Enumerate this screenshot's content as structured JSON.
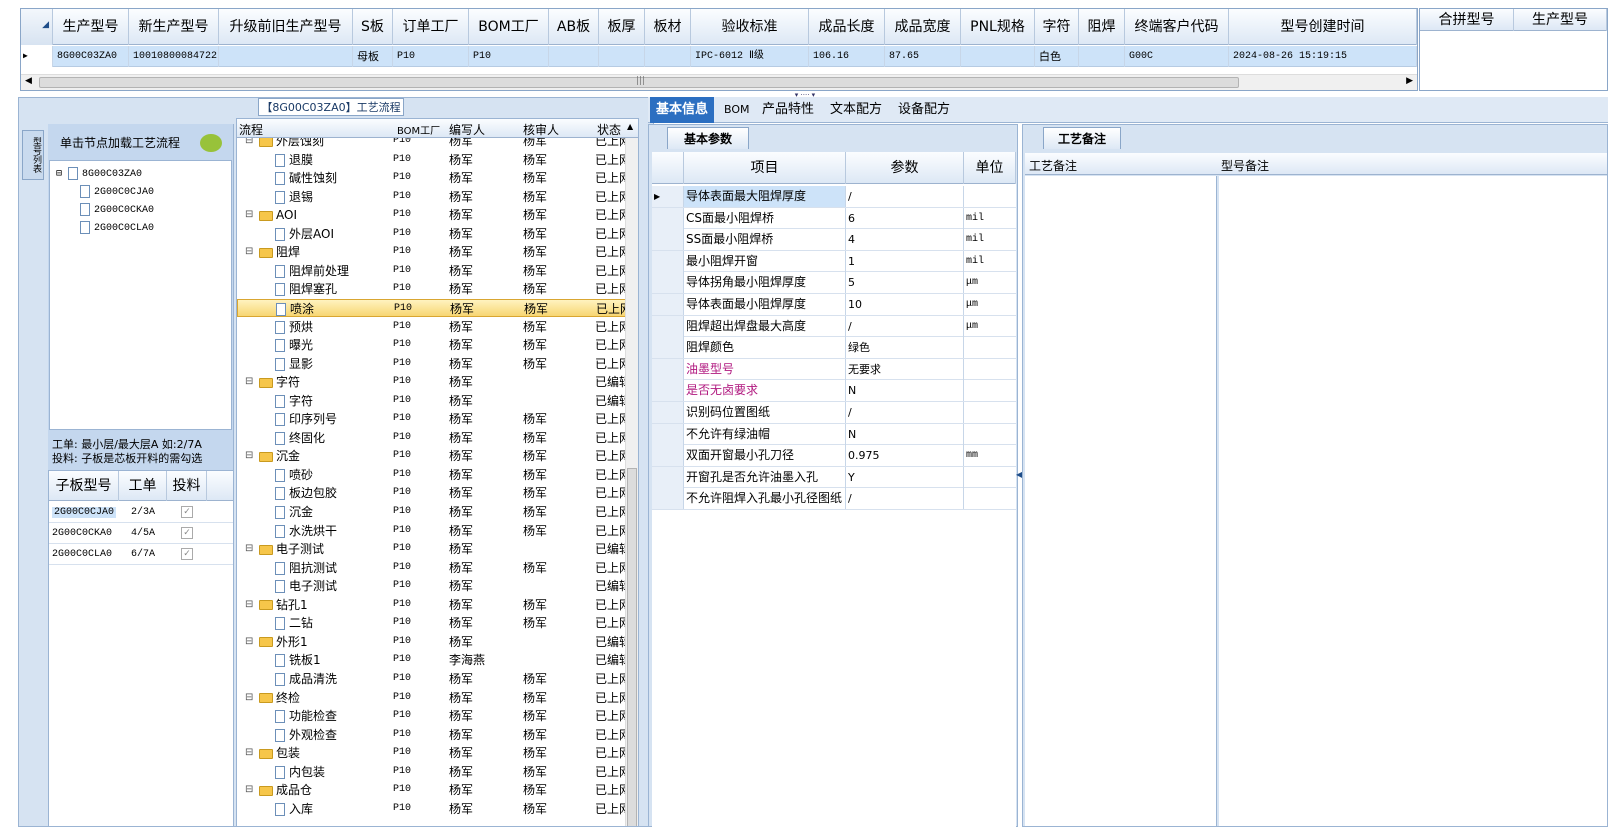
{
  "top_grid": {
    "headers": [
      "生产型号",
      "新生产型号",
      "升级前旧生产型号",
      "S板",
      "订单工厂",
      "BOM工厂",
      "AB板",
      "板厚",
      "板材",
      "验收标准",
      "成品长度",
      "成品宽度",
      "PNL规格",
      "字符",
      "阻焊",
      "终端客户代码",
      "型号创建时间"
    ],
    "row": {
      "model": "8G00C03ZA0",
      "new_model": "10010800084722",
      "old_model": "",
      "s_board": "母板",
      "order_factory": "P10",
      "bom_factory": "P10",
      "ab": "",
      "thickness": "",
      "material": "",
      "standard": "IPC-6012 Ⅱ级",
      "length": "106.16",
      "width": "87.65",
      "pnl": "",
      "char": "白色",
      "mask": "",
      "customer": "G00C",
      "created": "2024-08-26 15:19:15"
    }
  },
  "right_grid": {
    "headers": [
      "合拼型号",
      "生产型号"
    ]
  },
  "flow_title": "【8G00C03ZA0】工艺流程",
  "node_panel": {
    "hint": "单击节点加载工艺流程",
    "side_tab": "型号列表",
    "tree_root": "8G00C03ZA0",
    "tree_children": [
      "2G00C0CJA0",
      "2G00C0CKA0",
      "2G00C0CLA0"
    ],
    "note1": "工单: 最小层/最大层A 如:2/7A",
    "note2": "投料: 子板是芯板开料的需勾选"
  },
  "sub_grid": {
    "headers": [
      "子板型号",
      "工单",
      "投料"
    ],
    "rows": [
      [
        "2G00C0CJA0",
        "2/3A"
      ],
      [
        "2G00C0CKA0",
        "4/5A"
      ],
      [
        "2G00C0CLA0",
        "6/7A"
      ]
    ]
  },
  "process_grid": {
    "headers": [
      "流程",
      "BOM工厂",
      "编写人",
      "核审人",
      "状态"
    ],
    "rows": [
      {
        "name": "外层蚀刻",
        "lvl": 1,
        "f": "P10",
        "w": "杨军",
        "r": "杨军",
        "s": "已上网"
      },
      {
        "name": "退膜",
        "lvl": 2,
        "f": "P10",
        "w": "杨军",
        "r": "杨军",
        "s": "已上网"
      },
      {
        "name": "碱性蚀刻",
        "lvl": 2,
        "f": "P10",
        "w": "杨军",
        "r": "杨军",
        "s": "已上网"
      },
      {
        "name": "退锡",
        "lvl": 2,
        "f": "P10",
        "w": "杨军",
        "r": "杨军",
        "s": "已上网"
      },
      {
        "name": "AOI",
        "lvl": 1,
        "f": "P10",
        "w": "杨军",
        "r": "杨军",
        "s": "已上网"
      },
      {
        "name": "外层AOI",
        "lvl": 2,
        "f": "P10",
        "w": "杨军",
        "r": "杨军",
        "s": "已上网"
      },
      {
        "name": "阻焊",
        "lvl": 1,
        "f": "P10",
        "w": "杨军",
        "r": "杨军",
        "s": "已上网"
      },
      {
        "name": "阻焊前处理",
        "lvl": 2,
        "f": "P10",
        "w": "杨军",
        "r": "杨军",
        "s": "已上网"
      },
      {
        "name": "阻焊塞孔",
        "lvl": 2,
        "f": "P10",
        "w": "杨军",
        "r": "杨军",
        "s": "已上网"
      },
      {
        "name": "喷涂",
        "lvl": 2,
        "f": "P10",
        "w": "杨军",
        "r": "杨军",
        "s": "已上网",
        "sel": true
      },
      {
        "name": "预烘",
        "lvl": 2,
        "f": "P10",
        "w": "杨军",
        "r": "杨军",
        "s": "已上网"
      },
      {
        "name": "曝光",
        "lvl": 2,
        "f": "P10",
        "w": "杨军",
        "r": "杨军",
        "s": "已上网"
      },
      {
        "name": "显影",
        "lvl": 2,
        "f": "P10",
        "w": "杨军",
        "r": "杨军",
        "s": "已上网"
      },
      {
        "name": "字符",
        "lvl": 1,
        "f": "P10",
        "w": "杨军",
        "r": "",
        "s": "已编辑"
      },
      {
        "name": "字符",
        "lvl": 2,
        "f": "P10",
        "w": "杨军",
        "r": "",
        "s": "已编辑"
      },
      {
        "name": "印序列号",
        "lvl": 2,
        "f": "P10",
        "w": "杨军",
        "r": "杨军",
        "s": "已上网"
      },
      {
        "name": "终固化",
        "lvl": 2,
        "f": "P10",
        "w": "杨军",
        "r": "杨军",
        "s": "已上网"
      },
      {
        "name": "沉金",
        "lvl": 1,
        "f": "P10",
        "w": "杨军",
        "r": "杨军",
        "s": "已上网"
      },
      {
        "name": "喷砂",
        "lvl": 2,
        "f": "P10",
        "w": "杨军",
        "r": "杨军",
        "s": "已上网"
      },
      {
        "name": "板边包胶",
        "lvl": 2,
        "f": "P10",
        "w": "杨军",
        "r": "杨军",
        "s": "已上网"
      },
      {
        "name": "沉金",
        "lvl": 2,
        "f": "P10",
        "w": "杨军",
        "r": "杨军",
        "s": "已上网"
      },
      {
        "name": "水洗烘干",
        "lvl": 2,
        "f": "P10",
        "w": "杨军",
        "r": "杨军",
        "s": "已上网"
      },
      {
        "name": "电子测试",
        "lvl": 1,
        "f": "P10",
        "w": "杨军",
        "r": "",
        "s": "已编辑"
      },
      {
        "name": "阻抗测试",
        "lvl": 2,
        "f": "P10",
        "w": "杨军",
        "r": "杨军",
        "s": "已上网"
      },
      {
        "name": "电子测试",
        "lvl": 2,
        "f": "P10",
        "w": "杨军",
        "r": "",
        "s": "已编辑"
      },
      {
        "name": "钻孔1",
        "lvl": 1,
        "f": "P10",
        "w": "杨军",
        "r": "杨军",
        "s": "已上网"
      },
      {
        "name": "二钻",
        "lvl": 2,
        "f": "P10",
        "w": "杨军",
        "r": "杨军",
        "s": "已上网"
      },
      {
        "name": "外形1",
        "lvl": 1,
        "f": "P10",
        "w": "杨军",
        "r": "",
        "s": "已编辑"
      },
      {
        "name": "铣板1",
        "lvl": 2,
        "f": "P10",
        "w": "李海燕",
        "r": "",
        "s": "已编辑"
      },
      {
        "name": "成品清洗",
        "lvl": 2,
        "f": "P10",
        "w": "杨军",
        "r": "杨军",
        "s": "已上网"
      },
      {
        "name": "终检",
        "lvl": 1,
        "f": "P10",
        "w": "杨军",
        "r": "杨军",
        "s": "已上网"
      },
      {
        "name": "功能检查",
        "lvl": 2,
        "f": "P10",
        "w": "杨军",
        "r": "杨军",
        "s": "已上网"
      },
      {
        "name": "外观检查",
        "lvl": 2,
        "f": "P10",
        "w": "杨军",
        "r": "杨军",
        "s": "已上网"
      },
      {
        "name": "包装",
        "lvl": 1,
        "f": "P10",
        "w": "杨军",
        "r": "杨军",
        "s": "已上网"
      },
      {
        "name": "内包装",
        "lvl": 2,
        "f": "P10",
        "w": "杨军",
        "r": "杨军",
        "s": "已上网"
      },
      {
        "name": "成品仓",
        "lvl": 1,
        "f": "P10",
        "w": "杨军",
        "r": "杨军",
        "s": "已上网"
      },
      {
        "name": "入库",
        "lvl": 2,
        "f": "P10",
        "w": "杨军",
        "r": "杨军",
        "s": "已上网"
      }
    ]
  },
  "tabs": [
    "基本信息",
    "BOM",
    "产品特性",
    "文本配方",
    "设备配方"
  ],
  "basic_params": {
    "title": "基本参数",
    "headers": [
      "项目",
      "参数",
      "单位"
    ],
    "rows": [
      [
        "导体表面最大阻焊厚度",
        "/",
        ""
      ],
      [
        "CS面最小阻焊桥",
        "6",
        "mil"
      ],
      [
        "SS面最小阻焊桥",
        "4",
        "mil"
      ],
      [
        "最小阻焊开窗",
        "1",
        "mil"
      ],
      [
        "导体拐角最小阻焊厚度",
        "5",
        "μm"
      ],
      [
        "导体表面最小阻焊厚度",
        "10",
        "μm"
      ],
      [
        "阻焊超出焊盘最大高度",
        "/",
        "μm"
      ],
      [
        "阻焊颜色",
        "绿色",
        ""
      ],
      [
        "油墨型号",
        "无要求",
        ""
      ],
      [
        "是否无卤要求",
        "N",
        ""
      ],
      [
        "识别码位置图纸",
        "/",
        ""
      ],
      [
        "不允许有绿油帽",
        "N",
        ""
      ],
      [
        "双面开窗最小孔刀径",
        "0.975",
        "mm"
      ],
      [
        "开窗孔是否允许油墨入孔",
        "Y",
        ""
      ],
      [
        "不允许阻焊入孔最小孔径图纸",
        "/",
        ""
      ]
    ],
    "highlight_rows": [
      8,
      9
    ],
    "highlight_color": "#b0177f"
  },
  "notes": {
    "title": "工艺备注",
    "col1": "工艺备注",
    "col2": "型号备注"
  },
  "colors": {
    "selection": "#cde3f9",
    "accent": "#2c6fc1"
  }
}
